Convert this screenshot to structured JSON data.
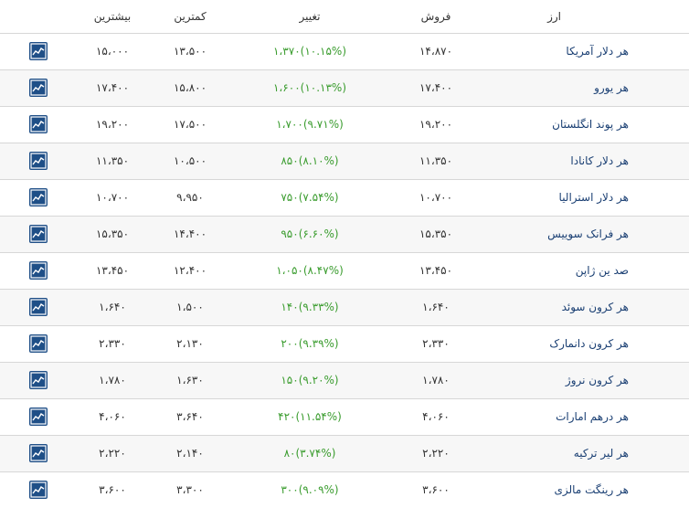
{
  "headers": {
    "currency": "ارز",
    "sell": "فروش",
    "change": "تغییر",
    "min": "کمترین",
    "max": "بیشترین"
  },
  "rows": [
    {
      "name": "هر دلار آمریکا",
      "sell": "۱۴،۸۷۰",
      "change": "۱،۳۷۰(۱۰.۱۵%)",
      "min": "۱۳،۵۰۰",
      "max": "۱۵،۰۰۰"
    },
    {
      "name": "هر یورو",
      "sell": "۱۷،۴۰۰",
      "change": "۱،۶۰۰(۱۰.۱۳%)",
      "min": "۱۵،۸۰۰",
      "max": "۱۷،۴۰۰"
    },
    {
      "name": "هر پوند انگلستان",
      "sell": "۱۹،۲۰۰",
      "change": "۱،۷۰۰(۹.۷۱%)",
      "min": "۱۷،۵۰۰",
      "max": "۱۹،۲۰۰"
    },
    {
      "name": "هر دلار کانادا",
      "sell": "۱۱،۳۵۰",
      "change": "۸۵۰(۸.۱۰%)",
      "min": "۱۰،۵۰۰",
      "max": "۱۱،۳۵۰"
    },
    {
      "name": "هر دلار استرالیا",
      "sell": "۱۰،۷۰۰",
      "change": "۷۵۰(۷.۵۴%)",
      "min": "۹،۹۵۰",
      "max": "۱۰،۷۰۰"
    },
    {
      "name": "هر فرانک سوییس",
      "sell": "۱۵،۳۵۰",
      "change": "۹۵۰(۶.۶۰%)",
      "min": "۱۴،۴۰۰",
      "max": "۱۵،۳۵۰"
    },
    {
      "name": "صد ین ژاپن",
      "sell": "۱۳،۴۵۰",
      "change": "۱،۰۵۰(۸.۴۷%)",
      "min": "۱۲،۴۰۰",
      "max": "۱۳،۴۵۰"
    },
    {
      "name": "هر کرون سوئد",
      "sell": "۱،۶۴۰",
      "change": "۱۴۰(۹.۳۳%)",
      "min": "۱،۵۰۰",
      "max": "۱،۶۴۰"
    },
    {
      "name": "هر کرون دانمارک",
      "sell": "۲،۳۳۰",
      "change": "۲۰۰(۹.۳۹%)",
      "min": "۲،۱۳۰",
      "max": "۲،۳۳۰"
    },
    {
      "name": "هر کرون نروژ",
      "sell": "۱،۷۸۰",
      "change": "۱۵۰(۹.۲۰%)",
      "min": "۱،۶۳۰",
      "max": "۱،۷۸۰"
    },
    {
      "name": "هر درهم امارات",
      "sell": "۴،۰۶۰",
      "change": "۴۲۰(۱۱.۵۴%)",
      "min": "۳،۶۴۰",
      "max": "۴،۰۶۰"
    },
    {
      "name": "هر لیر ترکیه",
      "sell": "۲،۲۲۰",
      "change": "۸۰(۳.۷۴%)",
      "min": "۲،۱۴۰",
      "max": "۲،۲۲۰"
    },
    {
      "name": "هر رینگت مالزی",
      "sell": "۳،۶۰۰",
      "change": "۳۰۰(۹.۰۹%)",
      "min": "۳،۳۰۰",
      "max": "۳،۶۰۰"
    }
  ],
  "icons": {
    "chart": "line-chart-icon"
  },
  "colors": {
    "change_positive": "#3a9c2e",
    "name_link": "#1a3f73",
    "icon_bg": "#1f4f87"
  }
}
